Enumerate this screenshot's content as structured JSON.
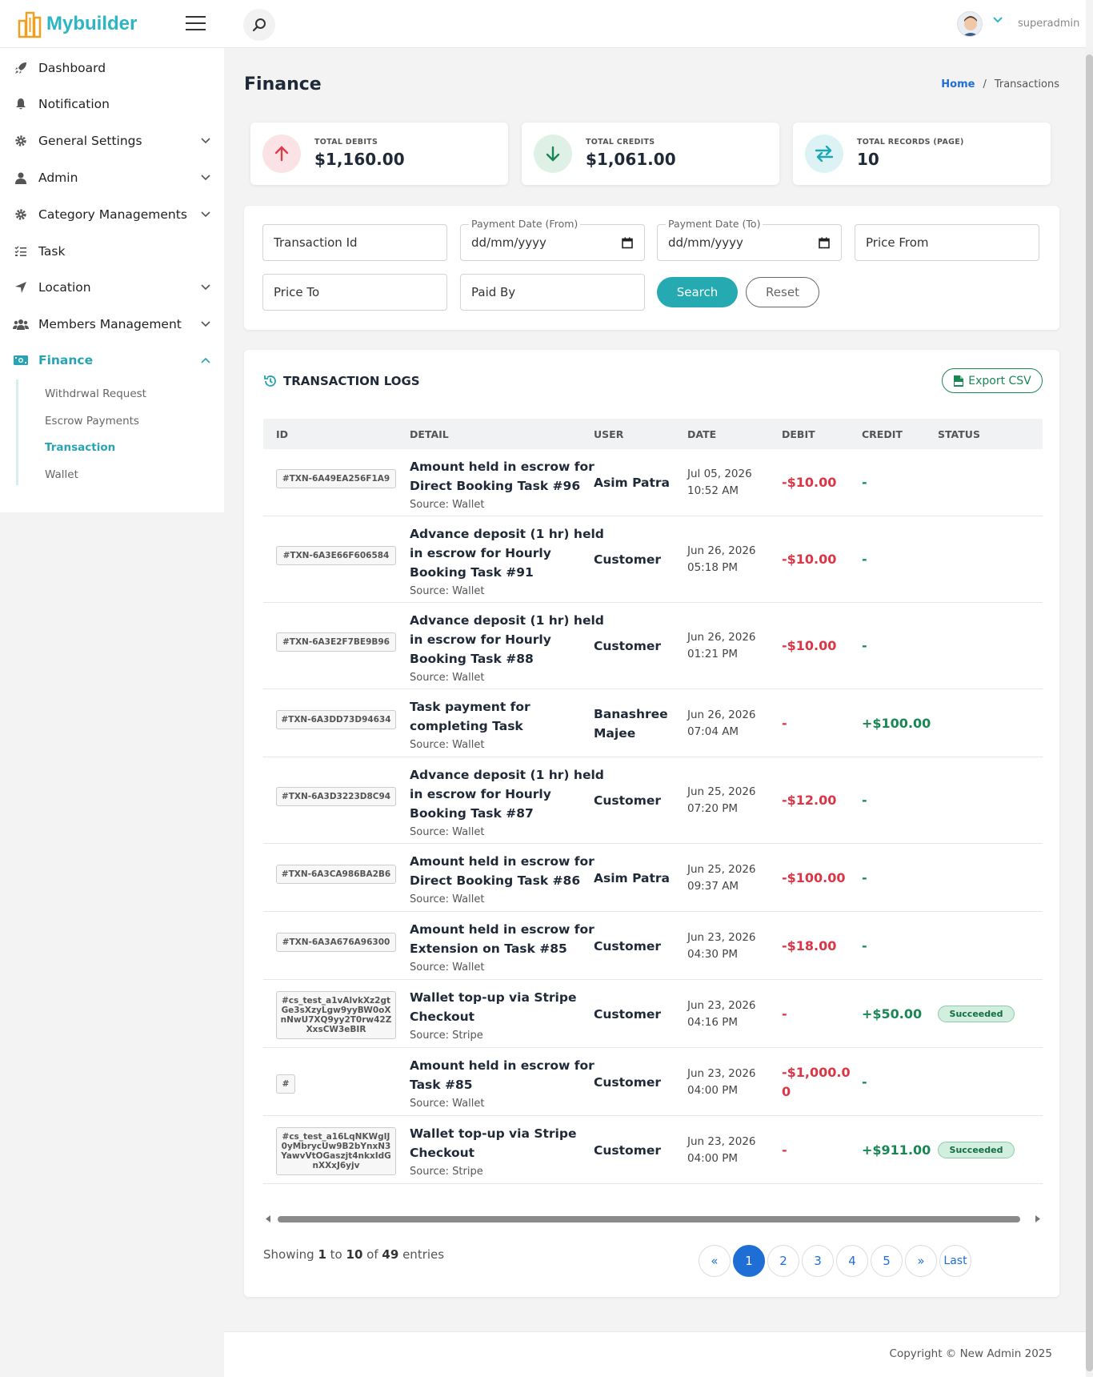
{
  "app": {
    "name": "Mybuilder"
  },
  "header": {
    "username": "superadmin"
  },
  "sidebar": {
    "items": [
      {
        "label": "Dashboard",
        "icon": "rocket-icon"
      },
      {
        "label": "Notification",
        "icon": "bell-icon"
      },
      {
        "label": "General Settings",
        "icon": "gear-icon"
      },
      {
        "label": "Admin",
        "icon": "user-icon"
      },
      {
        "label": "Category Managements",
        "icon": "gear-icon"
      },
      {
        "label": "Task",
        "icon": "tasks-icon"
      },
      {
        "label": "Location",
        "icon": "location-arrow-icon"
      },
      {
        "label": "Members Management",
        "icon": "users-icon"
      },
      {
        "label": "Finance",
        "icon": "money-icon"
      }
    ],
    "finance_sub": [
      "Withdrwal Request",
      "Escrow Payments",
      "Transaction",
      "Wallet"
    ],
    "active_color": "#27a3b3"
  },
  "page": {
    "title": "Finance"
  },
  "breadcrumb": {
    "home": "Home",
    "sep": "/",
    "current": "Transactions"
  },
  "stats": [
    {
      "label": "TOTAL DEBITS",
      "value": "$1,160.00",
      "icon": "arrow-up-icon",
      "color": "#e03b4c",
      "bg": "#fbe3e5"
    },
    {
      "label": "TOTAL CREDITS",
      "value": "$1,061.00",
      "icon": "arrow-down-icon",
      "color": "#198754",
      "bg": "#dff1e7"
    },
    {
      "label": "TOTAL RECORDS (PAGE)",
      "value": "10",
      "icon": "exchange-icon",
      "color": "#1ba8b5",
      "bg": "#dcf2f4"
    }
  ],
  "filters": {
    "transaction_id": "Transaction Id",
    "payment_from_label": "Payment Date (From)",
    "payment_from_value": "dd/mm/yyyy",
    "payment_to_label": "Payment Date (To)",
    "payment_to_value": "dd/mm/yyyy",
    "price_from": "Price From",
    "price_to": "Price To",
    "paid_by": "Paid By",
    "search": "Search",
    "reset": "Reset"
  },
  "logs": {
    "title": "TRANSACTION LOGS",
    "export": "Export CSV",
    "columns": [
      "ID",
      "DETAIL",
      "USER",
      "DATE",
      "DEBIT",
      "CREDIT",
      "STATUS"
    ],
    "rows": [
      {
        "id": "#TXN-6A49EA256F1A9",
        "title": "Amount held in escrow for Direct Booking Task #96",
        "source": "Source: Wallet",
        "user": "Asim Patra",
        "date": "Jul 05, 2026",
        "time": "10:52 AM",
        "debit": "-$10.00",
        "credit": "-",
        "status": ""
      },
      {
        "id": "#TXN-6A3E66F606584",
        "title": "Advance deposit (1 hr) held in escrow for Hourly Booking Task #91",
        "source": "Source: Wallet",
        "user": "Customer",
        "date": "Jun 26, 2026",
        "time": "05:18 PM",
        "debit": "-$10.00",
        "credit": "-",
        "status": ""
      },
      {
        "id": "#TXN-6A3E2F7BE9B96",
        "title": "Advance deposit (1 hr) held in escrow for Hourly Booking Task #88",
        "source": "Source: Wallet",
        "user": "Customer",
        "date": "Jun 26, 2026",
        "time": "01:21 PM",
        "debit": "-$10.00",
        "credit": "-",
        "status": ""
      },
      {
        "id": "#TXN-6A3DD73D94634",
        "title": "Task payment for completing Task",
        "source": "Source: Wallet",
        "user": "Banashree Majee",
        "date": "Jun 26, 2026",
        "time": "07:04 AM",
        "debit": "-",
        "credit": "+$100.00",
        "status": ""
      },
      {
        "id": "#TXN-6A3D3223D8C94",
        "title": "Advance deposit (1 hr) held in escrow for Hourly Booking Task #87",
        "source": "Source: Wallet",
        "user": "Customer",
        "date": "Jun 25, 2026",
        "time": "07:20 PM",
        "debit": "-$12.00",
        "credit": "-",
        "status": ""
      },
      {
        "id": "#TXN-6A3CA986BA2B6",
        "title": "Amount held in escrow for Direct Booking Task #86",
        "source": "Source: Wallet",
        "user": "Asim Patra",
        "date": "Jun 25, 2026",
        "time": "09:37 AM",
        "debit": "-$100.00",
        "credit": "-",
        "status": ""
      },
      {
        "id": "#TXN-6A3A676A96300",
        "title": "Amount held in escrow for Extension on Task #85",
        "source": "Source: Wallet",
        "user": "Customer",
        "date": "Jun 23, 2026",
        "time": "04:30 PM",
        "debit": "-$18.00",
        "credit": "-",
        "status": ""
      },
      {
        "id": "#cs_test_a1vAlvkXz2gtGe3sXzyLgw9yyBW0oXnNwU7XQ9yy2T0rw42ZXxsCW3eBIR",
        "title": "Wallet top-up via Stripe Checkout",
        "source": "Source: Stripe",
        "user": "Customer",
        "date": "Jun 23, 2026",
        "time": "04:16 PM",
        "debit": "-",
        "credit": "+$50.00",
        "status": "Succeeded"
      },
      {
        "id": "#",
        "title": "Amount held in escrow for Task #85",
        "source": "Source: Wallet",
        "user": "Customer",
        "date": "Jun 23, 2026",
        "time": "04:00 PM",
        "debit": "-$1,000.00",
        "credit": "-",
        "status": ""
      },
      {
        "id": "#cs_test_a16LqNKWgIJ0yMbrycUw9B2bYnxN3YawvVtOGaszjt4nkxIdGnXXxJ6yjv",
        "title": "Wallet top-up via Stripe Checkout",
        "source": "Source: Stripe",
        "user": "Customer",
        "date": "Jun 23, 2026",
        "time": "04:00 PM",
        "debit": "-",
        "credit": "+$911.00",
        "status": "Succeeded"
      }
    ]
  },
  "pagination": {
    "showing_prefix": "Showing",
    "from": "1",
    "to_word": "to",
    "to": "10",
    "of_word": "of",
    "total": "49",
    "suffix": "entries",
    "pages": [
      "«",
      "1",
      "2",
      "3",
      "4",
      "5",
      "»",
      "Last"
    ],
    "current": "1"
  },
  "footer": {
    "copyright": "Copyright © New Admin 2025"
  }
}
